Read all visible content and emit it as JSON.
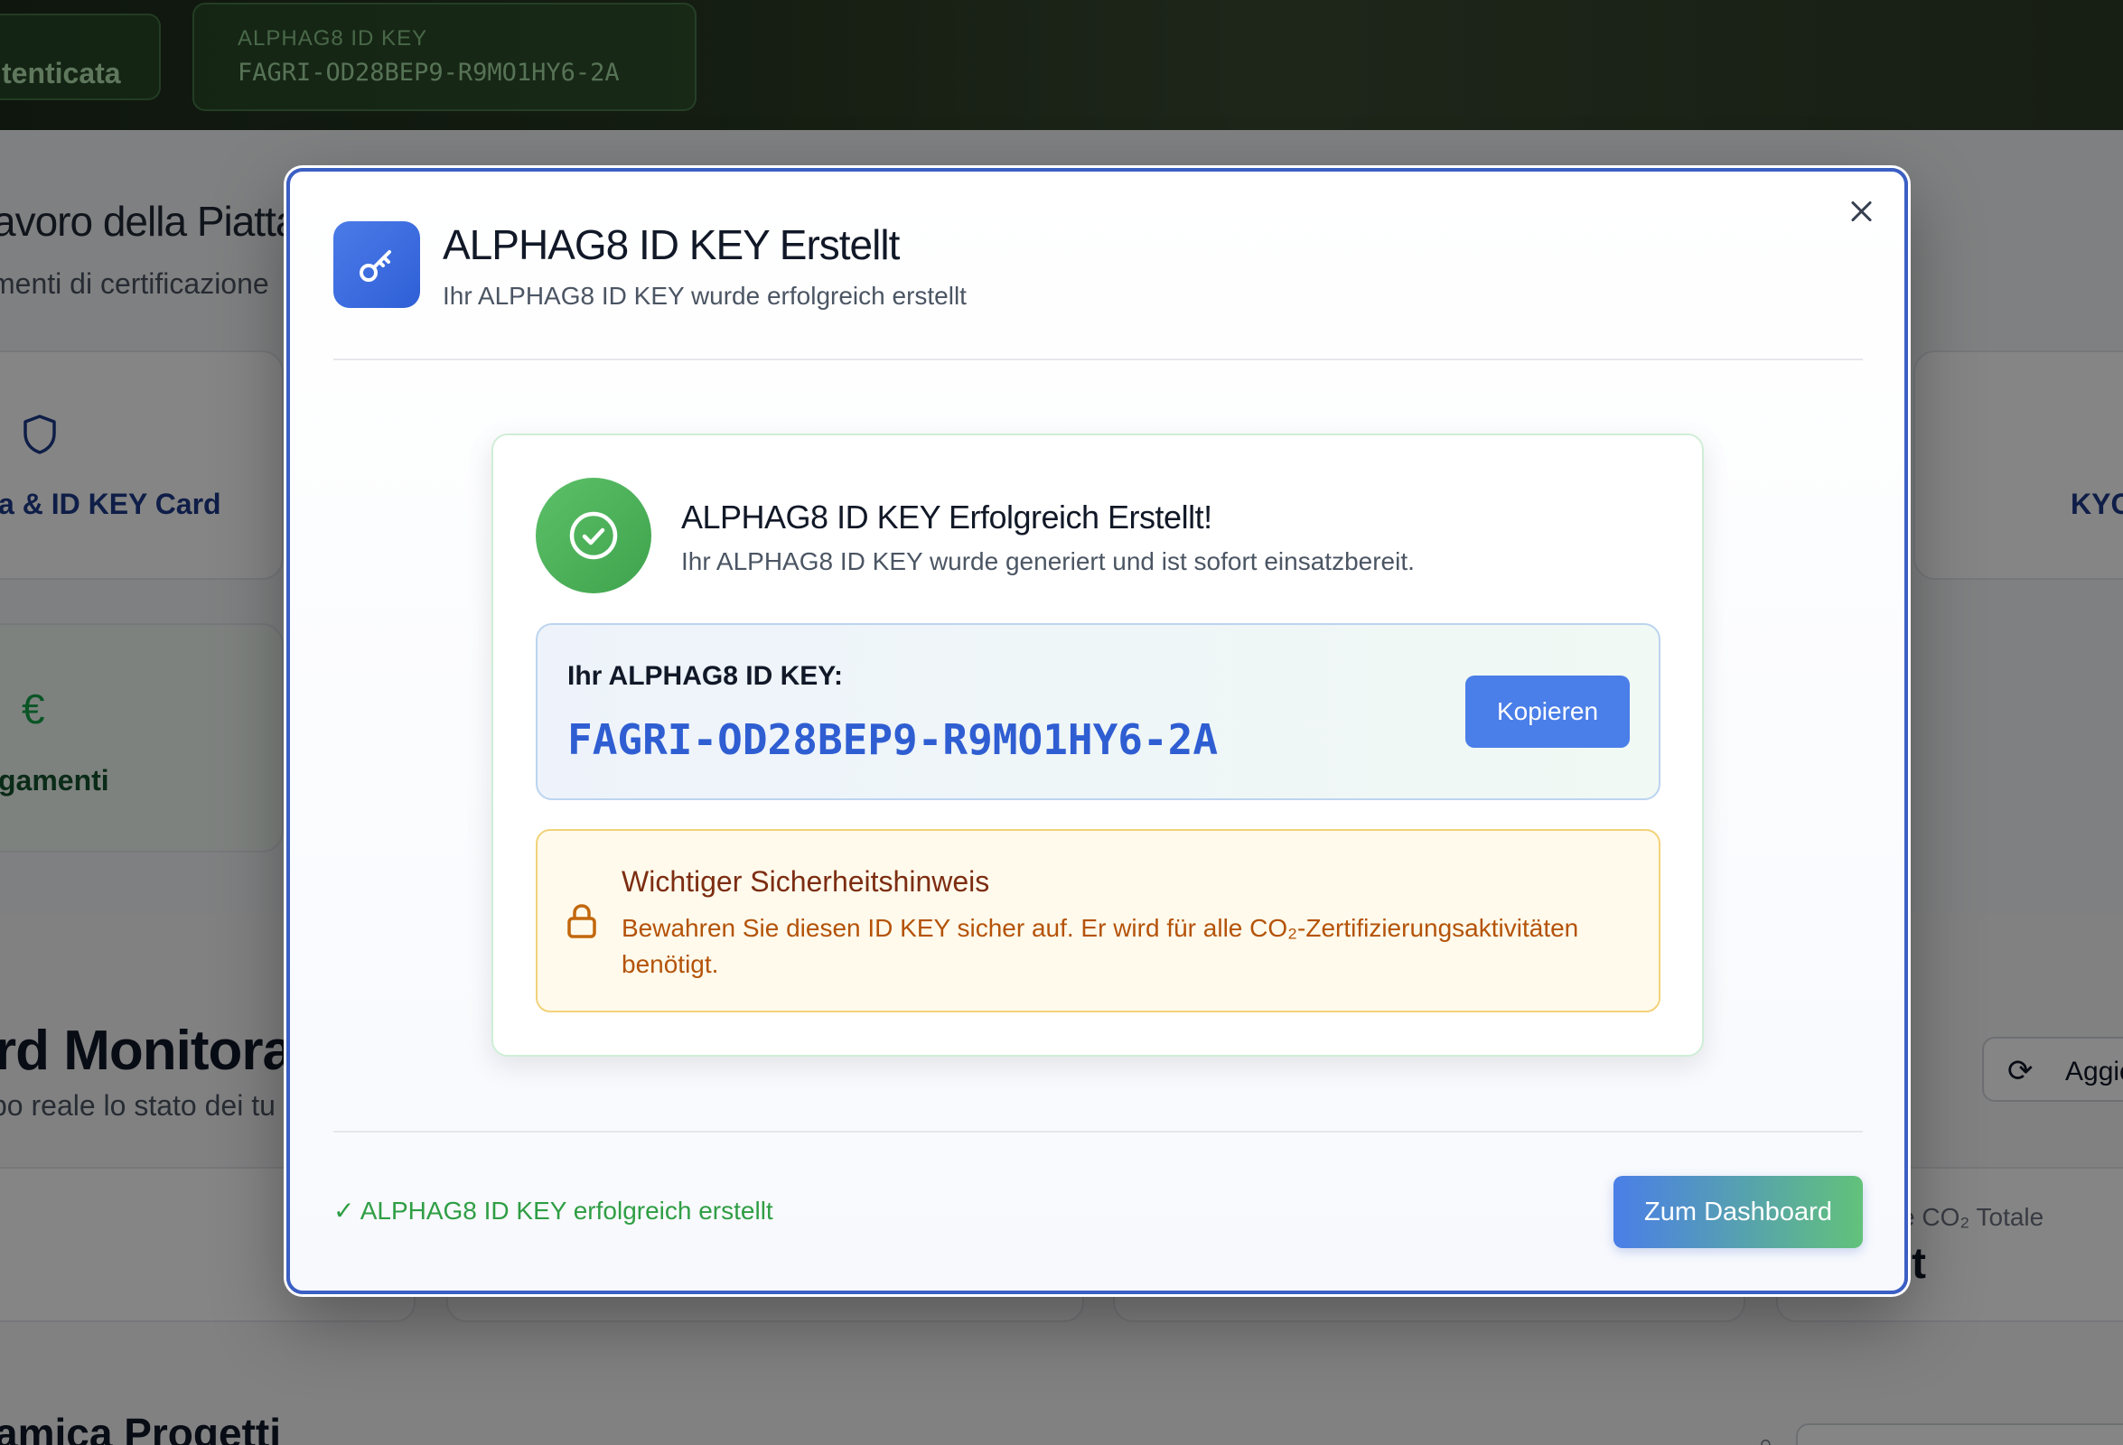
{
  "background": {
    "auth_pill": "tenticata",
    "key_pill_label": "ALPHAG8 ID KEY",
    "key_pill_value": "FAGRI-OD28BEP9-R9MO1HY6-2A",
    "section_title": "avoro della Piattaf",
    "section_sub": "menti di certificazione",
    "card1_label": "a & ID KEY Card",
    "card2_label": "gamenti",
    "card3_label": "KYC",
    "dashboard_title": "rd Monitorag",
    "dashboard_sub": "po reale lo stato dei tu",
    "refresh_label": "Aggio",
    "stat_label": "e CO₂ Totale",
    "stat_value": "t",
    "projects_title": "amica Progetti",
    "icons": {
      "shield": "shield-icon",
      "euro": "euro-icon",
      "refresh": "refresh-icon",
      "search": "search-icon"
    }
  },
  "modal": {
    "title": "ALPHAG8 ID KEY Erstellt",
    "subtitle": "Ihr ALPHAG8 ID KEY wurde erfolgreich erstellt",
    "header_icon": "key-icon",
    "close_icon": "close-icon",
    "success": {
      "icon": "check-circle-icon",
      "title": "ALPHAG8 ID KEY Erfolgreich Erstellt!",
      "subtitle": "Ihr ALPHAG8 ID KEY wurde generiert und ist sofort einsatzbereit."
    },
    "key": {
      "label": "Ihr ALPHAG8 ID KEY:",
      "value": "FAGRI-OD28BEP9-R9MO1HY6-2A",
      "copy_label": "Kopieren"
    },
    "warning": {
      "icon": "lock-icon",
      "title": "Wichtiger Sicherheitshinweis",
      "text": "Bewahren Sie diesen ID KEY sicher auf. Er wird für alle CO₂-Zertifizierungsaktivitäten benötigt."
    },
    "footer": {
      "status": "✓ ALPHAG8 ID KEY erfolgreich erstellt",
      "dashboard_label": "Zum Dashboard"
    }
  },
  "colors": {
    "accent": "#4a7ee8",
    "success": "#3fa34d",
    "warning_text": "#b45309",
    "key_text": "#2f5ed2"
  }
}
